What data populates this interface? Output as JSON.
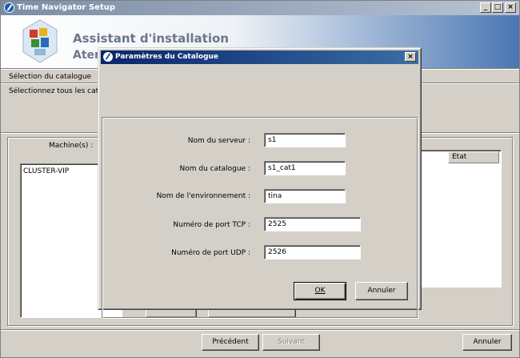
{
  "window": {
    "title": "Time Navigator Setup",
    "controls": [
      "_",
      "□",
      "×"
    ]
  },
  "banner": {
    "title": "Assistant d'installation",
    "subtitle": "Ater"
  },
  "section": {
    "title": "Sélection du catalogue",
    "description": "Sélectionnez tous les catalo"
  },
  "machines": {
    "label": "Machine(s) :",
    "items": [
      "CLUSTER-VIP"
    ]
  },
  "right_table": {
    "columns": [
      "Etat"
    ]
  },
  "footer": {
    "previous": "Précédent",
    "next": "Suivant",
    "cancel": "Annuler"
  },
  "dialog": {
    "title": "Paramètres du Catalogue",
    "close": "×",
    "fields": [
      {
        "label": "Nom du serveur :",
        "value": "s1"
      },
      {
        "label": "Nom du catalogue :",
        "value": "s1_cat1"
      },
      {
        "label": "Nom de l'environnement :",
        "value": "tina"
      },
      {
        "label": "Numéro de port TCP :",
        "value": "2525"
      },
      {
        "label": "Numéro de port UDP :",
        "value": "2526"
      }
    ],
    "ok": "OK",
    "cancel": "Annuler"
  },
  "colors": {
    "face": "#d4d0c8",
    "active_title": "#0a246a",
    "inactive_title": "#7b8da5"
  }
}
